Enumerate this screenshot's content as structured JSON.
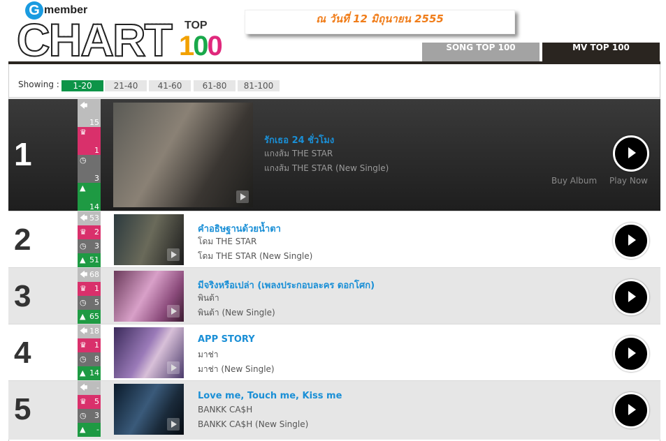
{
  "header": {
    "logo_brand": "member",
    "logo_g": "G",
    "logo_chart": "CHART",
    "logo_top": "TOP",
    "logo_100": "100",
    "date_text": "ณ วันที่ 12 มิถุนายน 2555"
  },
  "tabs": [
    {
      "label": "SONG TOP 100",
      "active": false
    },
    {
      "label": "MV TOP 100",
      "active": true
    }
  ],
  "showing": {
    "label": "Showing :",
    "pages": [
      "1-20",
      "21-40",
      "41-60",
      "61-80",
      "81-100"
    ],
    "active_page": "1-20"
  },
  "rows": [
    {
      "rank": "1",
      "prev": "15",
      "peak": "1",
      "weeks": "3",
      "move": "14",
      "title": "รักเธอ 24 ชั่วโมง",
      "artist": "แกงส้ม THE STAR",
      "album": "แกงส้ม THE STAR (New Single)",
      "buy_album": "Buy Album",
      "play_now": "Play Now"
    },
    {
      "rank": "2",
      "prev": "53",
      "peak": "2",
      "weeks": "3",
      "move": "51",
      "title": "คำอธิษฐานด้วยน้ำตา",
      "artist": "โดม THE STAR",
      "album": "โดม THE STAR (New Single)"
    },
    {
      "rank": "3",
      "prev": "68",
      "peak": "1",
      "weeks": "5",
      "move": "65",
      "title": "มีจริงหรือเปล่า (เพลงประกอบละคร ดอกโศก)",
      "artist": "พินต้า",
      "album": "พินต้า (New Single)"
    },
    {
      "rank": "4",
      "prev": "18",
      "peak": "1",
      "weeks": "8",
      "move": "14",
      "title": "APP STORY",
      "artist": "มาช่า",
      "album": "มาช่า (New Single)"
    },
    {
      "rank": "5",
      "prev": "-",
      "peak": "5",
      "weeks": "3",
      "move": "-",
      "title": "Love me, Touch me, Kiss me",
      "artist": "BANKK CA$H",
      "album": "BANKK CA$H (New Single)"
    }
  ],
  "colors": {
    "accent_green": "#0d9448",
    "title_blue": "#1a8fd6",
    "peak_pink": "#d9306b",
    "date_orange": "#f07d1a"
  }
}
